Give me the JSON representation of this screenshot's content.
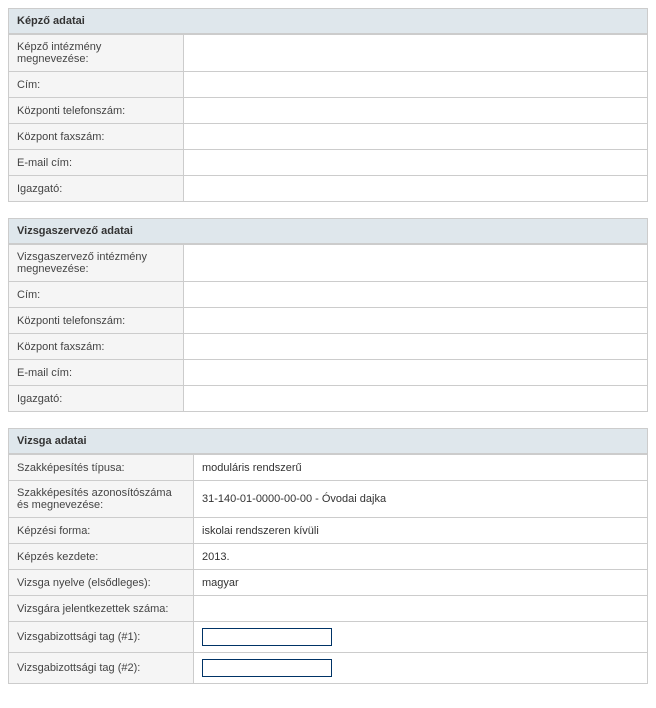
{
  "sections": {
    "kepzo": {
      "title": "Képző adatai",
      "rows": {
        "intezmeny": {
          "label": "Képző intézmény megnevezése:",
          "value": ""
        },
        "cim": {
          "label": "Cím:",
          "value": ""
        },
        "telefon": {
          "label": "Központi telefonszám:",
          "value": ""
        },
        "fax": {
          "label": "Központ faxszám:",
          "value": ""
        },
        "email": {
          "label": "E-mail cím:",
          "value": ""
        },
        "igazgato": {
          "label": "Igazgató:",
          "value": ""
        }
      }
    },
    "vizsgaszervezo": {
      "title": "Vizsgaszervező adatai",
      "rows": {
        "intezmeny": {
          "label": "Vizsgaszervező intézmény megnevezése:",
          "value": ""
        },
        "cim": {
          "label": "Cím:",
          "value": ""
        },
        "telefon": {
          "label": "Központi telefonszám:",
          "value": ""
        },
        "fax": {
          "label": "Központ faxszám:",
          "value": ""
        },
        "email": {
          "label": "E-mail cím:",
          "value": ""
        },
        "igazgato": {
          "label": "Igazgató:",
          "value": ""
        }
      }
    },
    "vizsga": {
      "title": "Vizsga adatai",
      "rows": {
        "tipus": {
          "label": "Szakképesítés típusa:",
          "value": "moduláris rendszerű"
        },
        "azonosito": {
          "label": "Szakképesítés azonosítószáma és megnevezése:",
          "value": "31-140-01-0000-00-00 - Óvodai dajka"
        },
        "forma": {
          "label": "Képzési forma:",
          "value": "iskolai rendszeren kívüli"
        },
        "kezdet": {
          "label": "Képzés kezdete:",
          "value": "2013."
        },
        "nyelv": {
          "label": "Vizsga nyelve (elsődleges):",
          "value": "magyar"
        },
        "jelentkezettek": {
          "label": "Vizsgára jelentkezettek száma:",
          "value": ""
        },
        "tag1": {
          "label": "Vizsgabizottsági tag (#1):",
          "value": ""
        },
        "tag2": {
          "label": "Vizsgabizottsági tag (#2):",
          "value": ""
        }
      }
    }
  }
}
